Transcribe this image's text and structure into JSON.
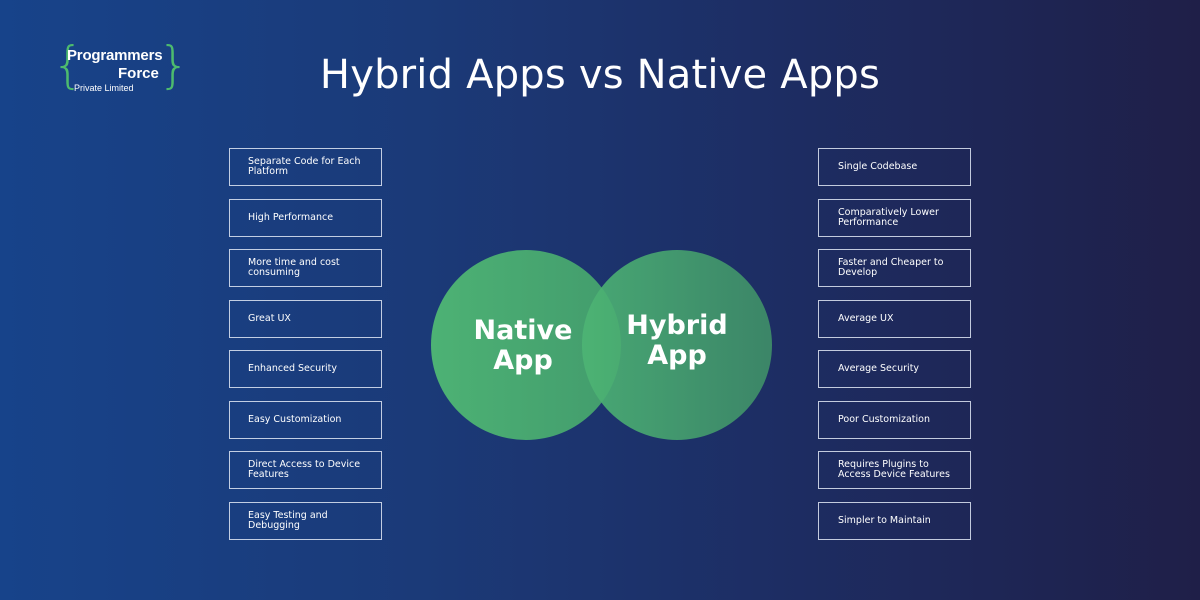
{
  "logo": {
    "line1": "Programmers",
    "line2": "Force",
    "line3": "Private Limited",
    "brace_left": "{",
    "brace_right": "}",
    "accent_color": "#4dbb6e"
  },
  "title": "Hybrid Apps vs Native Apps",
  "venn": {
    "left_label": "Native\nApp",
    "right_label": "Hybrid\nApp",
    "circle_color": "#4db574"
  },
  "native_features": [
    "Separate Code for Each Platform",
    "High Performance",
    "More time and cost consuming",
    "Great UX",
    "Enhanced Security",
    "Easy Customization",
    "Direct Access to Device Features",
    "Easy Testing and Debugging"
  ],
  "hybrid_features": [
    "Single Codebase",
    "Comparatively Lower Performance",
    "Faster and Cheaper to Develop",
    "Average UX",
    "Average Security",
    "Poor Customization",
    "Requires Plugins to Access Device Features",
    "Simpler to Maintain"
  ],
  "colors": {
    "background_left": "#17438a",
    "background_right": "#1f1f48",
    "box_border": "#e1e8f5",
    "text": "#ffffff"
  }
}
